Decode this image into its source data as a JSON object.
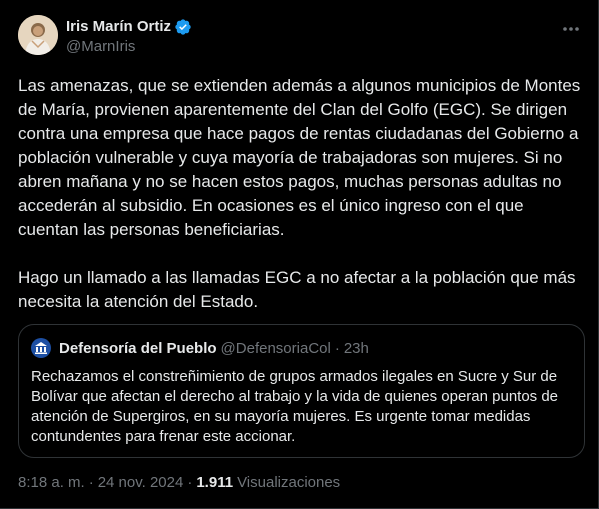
{
  "author": {
    "display_name": "Iris Marín Ortiz",
    "handle": "@MarnIris",
    "verified_icon": "verified-badge-icon",
    "avatar_icon": "profile-avatar-icon",
    "more_icon": "more-options-icon"
  },
  "tweet": {
    "paragraphs": [
      "Las amenazas, que se extienden además a algunos municipios de Montes de María, provienen aparentemente del Clan del Golfo (EGC). Se dirigen contra una empresa que hace pagos de rentas ciudadanas del Gobierno a población vulnerable y cuya mayoría de trabajadoras son mujeres. Si no abren mañana y no se hacen estos pagos, muchas personas adultas no accederán al subsidio. En ocasiones es el único ingreso con el que cuentan las personas beneficiarias.",
      "Hago un llamado a las llamadas EGC a no afectar a la población que más necesita la atención del Estado."
    ]
  },
  "quote": {
    "display_name": "Defensoría del Pueblo",
    "handle": "@DefensoriaCol",
    "dot": "·",
    "time": "23h",
    "avatar_icon": "institution-avatar-icon",
    "text": "Rechazamos el constreñimiento de grupos armados ilegales en Sucre y Sur de Bolívar que afectan el derecho al trabajo y la vida de quienes operan puntos de atención de Supergiros, en su mayoría mujeres. Es urgente tomar medidas contundentes para frenar este accionar."
  },
  "meta": {
    "time": "8:18 a. m.",
    "separator": "·",
    "date": "24 nov. 2024",
    "views_count": "1.911",
    "views_label": "Visualizaciones"
  },
  "colors": {
    "background": "#000000",
    "text": "#e7e9ea",
    "secondary": "#71767b",
    "border": "#2f3336",
    "verified": "#1d9bf0"
  }
}
